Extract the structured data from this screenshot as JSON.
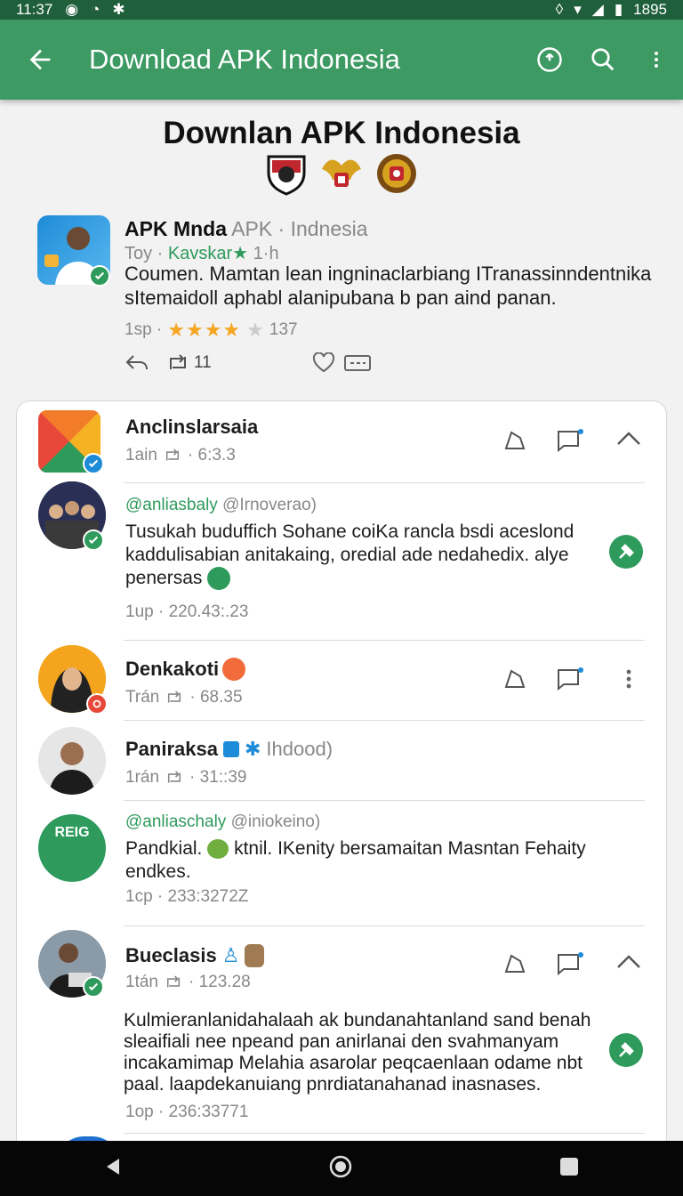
{
  "status_bar": {
    "time": "11:37",
    "right_text": "1895"
  },
  "appbar": {
    "title": "Download APK Indonesia"
  },
  "header": {
    "page_title": "Downlan APK Indonesia"
  },
  "post1": {
    "name": "APK Mnda",
    "handle": "APK · Indnesia",
    "sub_prefix": "Toy ·",
    "sub_green": "Kavskar★",
    "sub_time": "1·h",
    "body": "Coumen. Mamtan lean ingninaclarbiang ITranassinndentnika sItemaidoll aphabl alanipubana b pan aind panan.",
    "meta_prefix": "1sp ·",
    "stars": "★★★★",
    "star_empty": "★",
    "rating_count": "137",
    "repost_count": "11"
  },
  "card": {
    "entry1": {
      "name": "Anclinslarsaia",
      "meta": "1ain",
      "time": "· 6:3.3"
    },
    "comment1": {
      "handle": "@anliasbaly",
      "handle2": "@Irnoverao)",
      "body": "Tusukah buduffich Sohane coiKa rancla bsdi aceslond kaddulisabian anitakaing, oredial ade nedahedix. alye penersas",
      "meta": "1up · 220.43:.23"
    },
    "entry2": {
      "name": "Denkakoti",
      "meta": "Trán",
      "time": "· 68.35"
    },
    "entry3": {
      "name": "Paniraksa",
      "tag": "Ihdood)",
      "meta": "1rán",
      "time": "· 31::39"
    },
    "comment2": {
      "handle": "@anliaschaly",
      "handle2": "@iniokeino)",
      "body_a": "Pandkial.",
      "body_b": "ktnil. IKenity bersamaitan Masntan Fehaity endkes.",
      "meta": "1cp · 233:3272Z",
      "avatar_text": "REIG"
    },
    "entry4": {
      "name": "Bueclasis",
      "meta": "1tán",
      "time": "· 123.28",
      "body": "Kulmieranlanidahalaah ak bundanahtanland sand benah sleaifiali nee npeand pan anirlanai den svahmanyam incakamimap Melahia asarolar peqcaenlaan odame nbt paal. laapdekanuiang pnrdiatanahanad inasnases.",
      "meta2": "1op · 236:33771"
    }
  },
  "icons": [
    "back-icon",
    "info-icon",
    "search-icon",
    "more-icon",
    "reply-icon",
    "repost-icon",
    "heart-icon",
    "share-icon",
    "bookmark-icon",
    "comment-icon",
    "chevron-up-icon",
    "verified-icon"
  ],
  "colors": {
    "primary": "#3c9a62",
    "status": "#1f5f3c",
    "accent_green": "#2f9a5b",
    "star": "#f5a623"
  }
}
